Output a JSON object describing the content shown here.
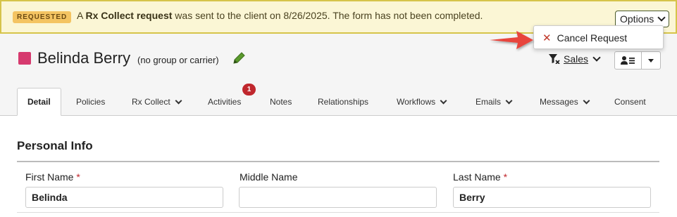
{
  "banner": {
    "badge": "REQUESTED",
    "text_prefix": "A ",
    "text_bold": "Rx Collect request",
    "text_suffix": " was sent to the client on 8/26/2025. The form has not been completed.",
    "options_label": "Options"
  },
  "dropdown": {
    "cancel_label": "Cancel Request",
    "cancel_icon": "x-icon"
  },
  "header": {
    "client_name": "Belinda Berry",
    "group_label": "(no group or carrier)",
    "color": "#d63a6e",
    "sales_label": "Sales"
  },
  "tabs": [
    {
      "label": "Detail",
      "active": true,
      "dropdown": false
    },
    {
      "label": "Policies",
      "active": false,
      "dropdown": false
    },
    {
      "label": "Rx Collect",
      "active": false,
      "dropdown": true
    },
    {
      "label": "Activities",
      "active": false,
      "dropdown": false,
      "badge": "1"
    },
    {
      "label": "Notes",
      "active": false,
      "dropdown": false
    },
    {
      "label": "Relationships",
      "active": false,
      "dropdown": false
    },
    {
      "label": "Workflows",
      "active": false,
      "dropdown": true
    },
    {
      "label": "Emails",
      "active": false,
      "dropdown": true
    },
    {
      "label": "Messages",
      "active": false,
      "dropdown": true
    },
    {
      "label": "Consent",
      "active": false,
      "dropdown": false
    }
  ],
  "personal_info": {
    "title": "Personal Info",
    "fields": [
      {
        "label": "First Name",
        "required": "*",
        "value": "Belinda"
      },
      {
        "label": "Middle Name",
        "required": "",
        "value": ""
      },
      {
        "label": "Last Name",
        "required": "*",
        "value": "Berry"
      }
    ]
  }
}
